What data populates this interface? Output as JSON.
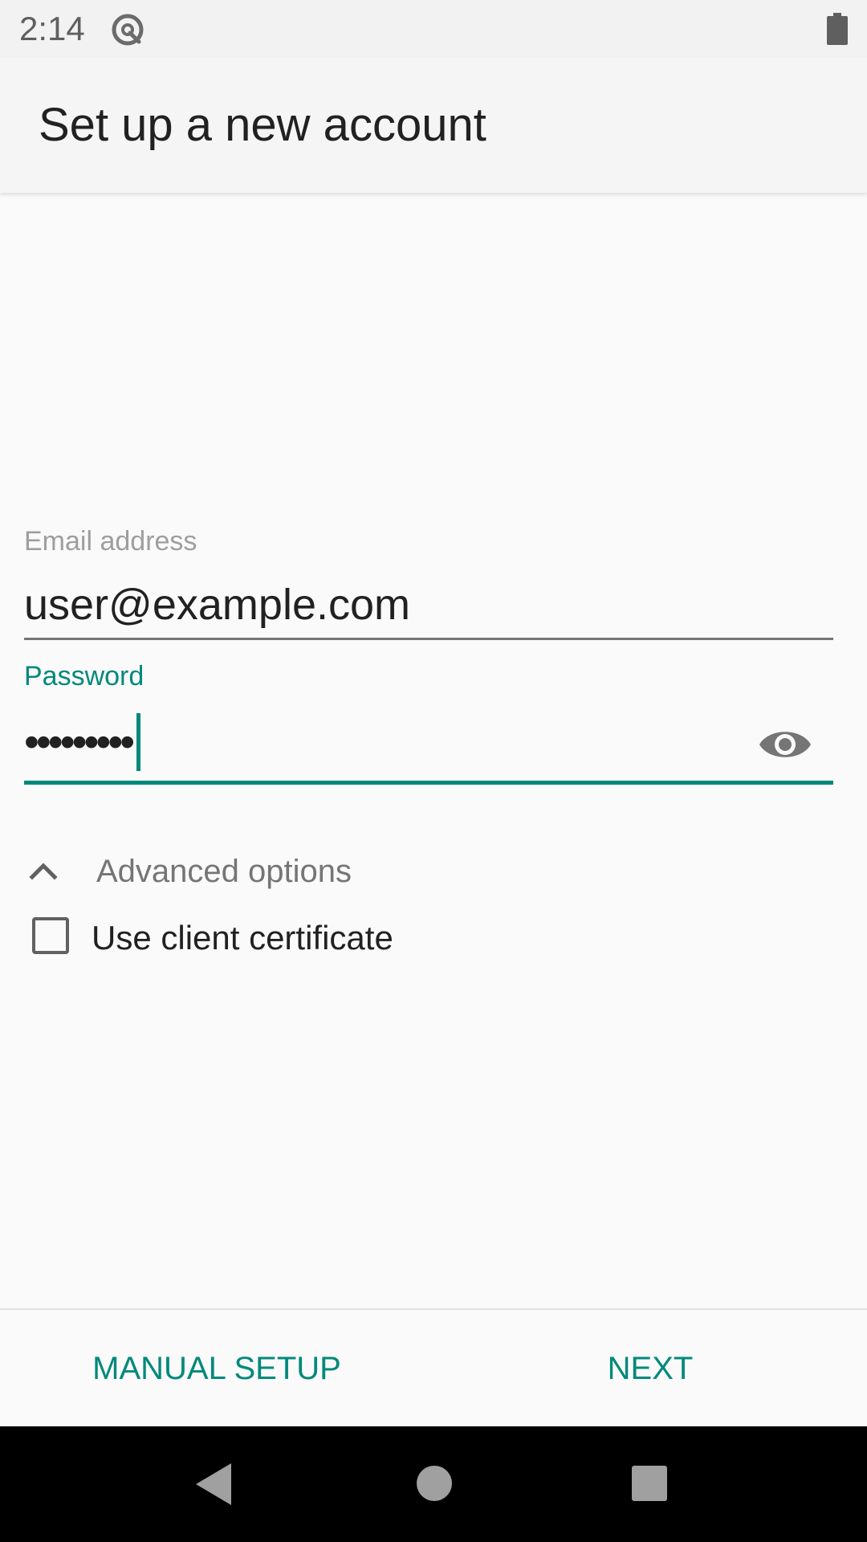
{
  "status_bar": {
    "time": "2:14",
    "app_icon": "at-sign-icon",
    "battery_icon": "battery-icon"
  },
  "app_bar": {
    "title": "Set up a new account"
  },
  "form": {
    "email": {
      "label": "Email address",
      "value": "user@example.com"
    },
    "password": {
      "label": "Password",
      "masked_value": "•••••••••",
      "visibility_icon": "eye-icon"
    },
    "advanced": {
      "label": "Advanced options",
      "expanded": true,
      "icon": "chevron-up-icon"
    },
    "client_certificate": {
      "label": "Use client certificate",
      "checked": false
    }
  },
  "buttons": {
    "manual_setup": "MANUAL SETUP",
    "next": "NEXT"
  },
  "nav_bar": {
    "back_icon": "back-icon",
    "home_icon": "home-icon",
    "recents_icon": "recents-icon"
  },
  "colors": {
    "accent": "#00897b",
    "text_primary": "#212121",
    "text_secondary": "#757575",
    "background": "#fafafa"
  }
}
